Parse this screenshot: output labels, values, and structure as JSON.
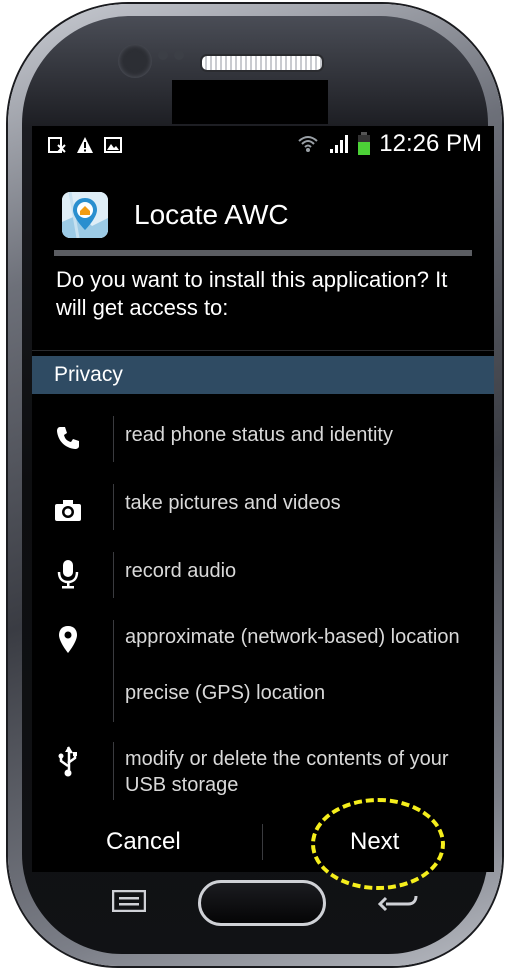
{
  "status_bar": {
    "time": "12:26 PM",
    "left_icons": [
      "message-icon",
      "warning-icon",
      "image-icon"
    ],
    "right_icons": [
      "wifi-icon",
      "signal-icon",
      "battery-icon"
    ]
  },
  "app": {
    "name": "Locate AWC",
    "icon": "locate-awc-app-icon"
  },
  "prompt": "Do you want to install this application? It will get access to:",
  "section": {
    "label": "Privacy"
  },
  "permissions": [
    {
      "icon": "phone-icon",
      "text": "read phone status and identity"
    },
    {
      "icon": "camera-icon",
      "text": "take pictures and videos"
    },
    {
      "icon": "microphone-icon",
      "text": "record audio"
    },
    {
      "icon": "location-pin-icon",
      "text": "approximate (network-based) location\nprecise (GPS) location",
      "line1": "approximate (network-based) location",
      "line2": "precise (GPS) location"
    },
    {
      "icon": "usb-icon",
      "text": "modify or delete the contents of your USB storage"
    }
  ],
  "buttons": {
    "cancel": "Cancel",
    "next": "Next"
  },
  "colors": {
    "section_bar": "#2f4b63",
    "highlight": "#f5ee1c",
    "screen_bg": "#000000"
  }
}
